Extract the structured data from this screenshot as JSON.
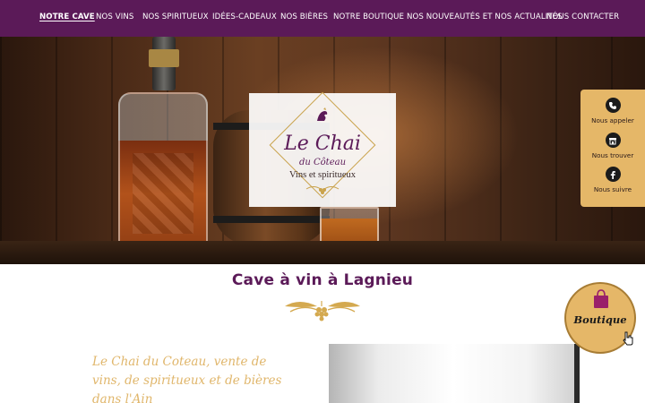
{
  "nav": {
    "items": [
      {
        "label": "NOTRE CAVE",
        "active": true
      },
      {
        "label": "NOS VINS"
      },
      {
        "label": "NOS SPIRITUEUX"
      },
      {
        "label": "IDÉES-CADEAUX"
      },
      {
        "label": "NOS BIÈRES"
      },
      {
        "label": "NOTRE BOUTIQUE"
      },
      {
        "label": "NOS NOUVEAUTÉS ET NOS ACTUALITÉS"
      },
      {
        "label": "NOUS CONTACTER"
      }
    ]
  },
  "logo": {
    "line1": "Le Chai",
    "line2": "du Côteau",
    "line3": "Vins et spiritueux"
  },
  "side_panel": {
    "call": {
      "label": "Nous appeler",
      "icon": "phone-icon"
    },
    "find": {
      "label": "Nous trouver",
      "icon": "store-icon"
    },
    "follow": {
      "label": "Nous suivre",
      "icon": "facebook-icon"
    }
  },
  "section": {
    "title": "Cave à vin à Lagnieu"
  },
  "intro": {
    "text": "Le Chai du Coteau, vente de vins, de spiritueux et de bières dans l'Ain"
  },
  "boutique_badge": {
    "label": "Boutique",
    "icon": "shopping-bag-icon"
  },
  "colors": {
    "brand_purple": "#5b1a58",
    "gold": "#e5b768",
    "script_gold": "#e0b66b"
  }
}
